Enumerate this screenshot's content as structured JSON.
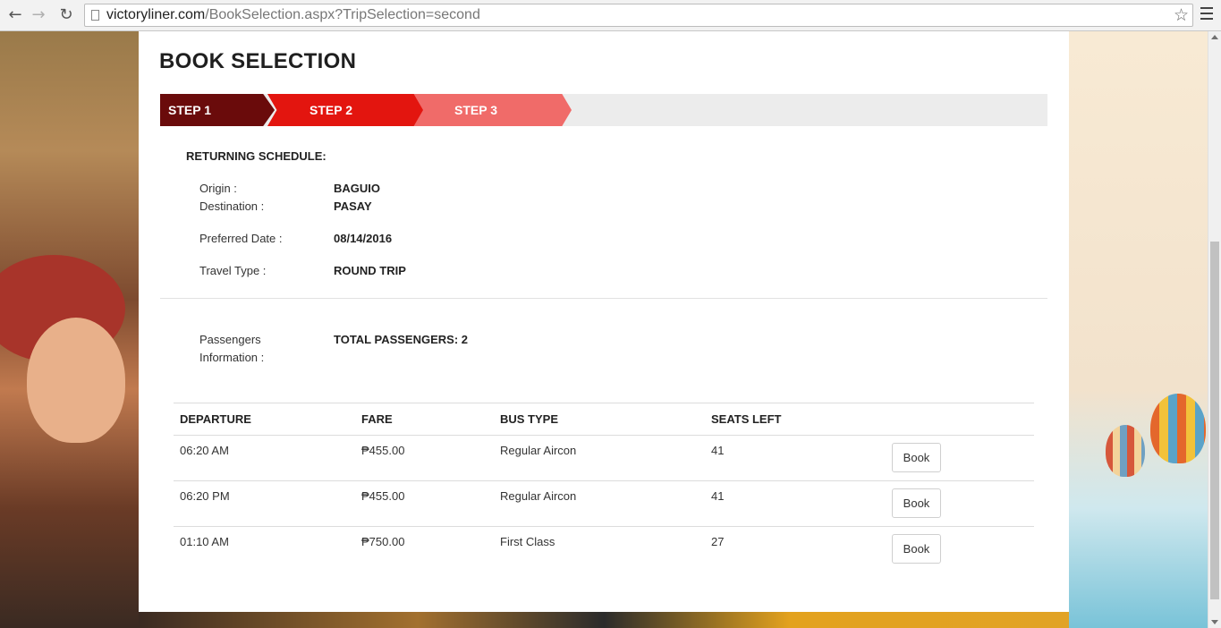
{
  "browser": {
    "url_domain": "victoryliner.com",
    "url_path": "/BookSelection.aspx?TripSelection=second"
  },
  "page": {
    "title": "BOOK SELECTION"
  },
  "steps": [
    {
      "label": "STEP 1",
      "color": "#6a0b0b"
    },
    {
      "label": "STEP 2",
      "color": "#e3150f"
    },
    {
      "label": "STEP 3",
      "color": "#f06b69"
    }
  ],
  "schedule": {
    "heading": "RETURNING SCHEDULE:",
    "origin_label": "Origin :",
    "origin_value": "BAGUIO",
    "destination_label": "Destination :",
    "destination_value": "PASAY",
    "date_label": "Preferred Date :",
    "date_value": "08/14/2016",
    "travel_type_label": "Travel Type :",
    "travel_type_value": "ROUND TRIP"
  },
  "passengers": {
    "label_line1": "Passengers",
    "label_line2": "Information :",
    "value": "TOTAL PASSENGERS: 2"
  },
  "table": {
    "headers": [
      "DEPARTURE",
      "FARE",
      "BUS TYPE",
      "SEATS LEFT"
    ],
    "rows": [
      {
        "departure": "06:20 AM",
        "fare": "₱455.00",
        "bus_type": "Regular Aircon",
        "seats_left": "41",
        "action": "Book"
      },
      {
        "departure": "06:20 PM",
        "fare": "₱455.00",
        "bus_type": "Regular Aircon",
        "seats_left": "41",
        "action": "Book"
      },
      {
        "departure": "01:10 AM",
        "fare": "₱750.00",
        "bus_type": "First Class",
        "seats_left": "27",
        "action": "Book"
      }
    ]
  }
}
